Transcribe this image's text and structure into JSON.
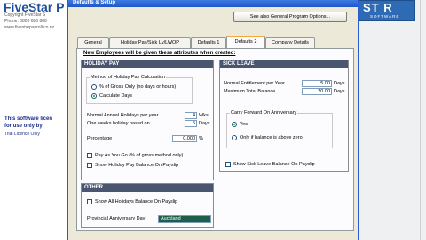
{
  "background": {
    "title": "FiveStar P",
    "lines": [
      "Copyright FiveStar S",
      "Phone: 0800 686 808",
      "www.fivestarpayroll.co.nz"
    ],
    "notice": [
      "This software licen",
      "for use only by"
    ],
    "trial": "Trial Licence Only",
    "logo_text": "ST R",
    "logo_sub": "SOFTWARE"
  },
  "dialog": {
    "title": "Defaults & Setup",
    "see_also_button": "See also General Program Options...",
    "tabs": [
      "General",
      "Holiday Pay/Sick Lv/LWOP",
      "Defaults 1",
      "Defaults 2",
      "Company Details"
    ],
    "active_tab": 3,
    "panel_heading": "New Employees will be given these attributes when created:",
    "holiday_pay": {
      "header": "HOLIDAY PAY",
      "method_group": "Method of Holiday Pay Calculation",
      "option_percent": "% of Gross Only (no days or hours)",
      "option_days": "Calculate Days",
      "selected_option": "Calculate Days",
      "annual_label": "Normal Annual Holidays per year",
      "annual_value": "4",
      "annual_unit": "Wks",
      "week_label": "One weeks holiday based on",
      "week_value": "5",
      "week_unit": "Days",
      "percentage_label": "Percentage",
      "percentage_value": "0.000",
      "percentage_unit": "%",
      "payg_label": "Pay As You Go (% of gross method only)",
      "show_balance_label": "Show Holiday Pay Balance On Payslip"
    },
    "sick_leave": {
      "header": "SICK LEAVE",
      "entitlement_label": "Normal Entitlement per Year",
      "entitlement_value": "5.00",
      "entitlement_unit": "Days",
      "max_label": "Maximum Total Balance",
      "max_value": "20.00",
      "max_unit": "Days",
      "carry_group": "Carry Forward On Anniversary",
      "carry_yes": "Yes",
      "carry_only": "Only if balance is above zero",
      "show_balance_label": "Show Sick Leave Balance On Payslip"
    },
    "other": {
      "header": "OTHER",
      "show_all_label": "Show All Holidays Balance On Payslip",
      "province_label": "Provincial Anniversary Day",
      "province_value": "Auckland"
    }
  }
}
